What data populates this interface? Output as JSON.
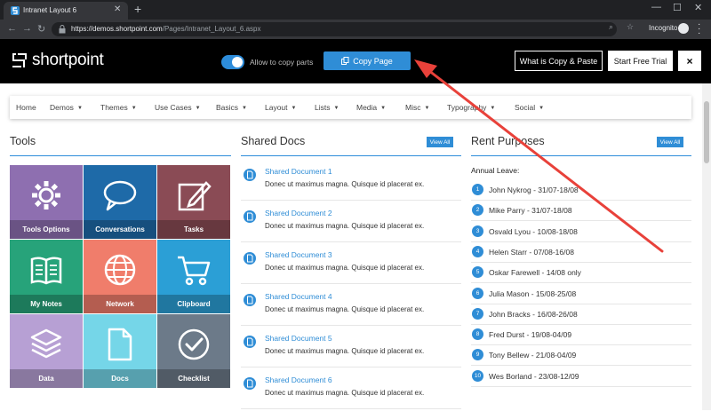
{
  "browser": {
    "tab_title": "Intranet Layout 6",
    "url_host": "https://demos.shortpoint.com",
    "url_path": "/Pages/Intranet_Layout_6.aspx",
    "incognito_label": "Incognito"
  },
  "header": {
    "logo_text": "shortpoint",
    "toggle_label": "Allow to copy parts",
    "toggle_on": true,
    "copy_button": "Copy Page",
    "what_button": "What is Copy & Paste",
    "trial_button": "Start Free Trial",
    "close_button": "×"
  },
  "nav": {
    "items": [
      {
        "label": "Home",
        "has_caret": false
      },
      {
        "label": "Demos",
        "has_caret": true
      },
      {
        "label": "Themes",
        "has_caret": true
      },
      {
        "label": "Use Cases",
        "has_caret": true
      },
      {
        "label": "Basics",
        "has_caret": true
      },
      {
        "label": "Layout",
        "has_caret": true
      },
      {
        "label": "Lists",
        "has_caret": true
      },
      {
        "label": "Media",
        "has_caret": true
      },
      {
        "label": "Misc",
        "has_caret": true
      },
      {
        "label": "Typography",
        "has_caret": true
      },
      {
        "label": "Social",
        "has_caret": true
      }
    ]
  },
  "tools": {
    "title": "Tools",
    "tiles": [
      {
        "label": "Tools Options",
        "icon": "gear-icon",
        "color": "#8e6fb0"
      },
      {
        "label": "Conversations",
        "icon": "chat-bubble-icon",
        "color": "#1e6aa8"
      },
      {
        "label": "Tasks",
        "icon": "pencil-square-icon",
        "color": "#8a4b55"
      },
      {
        "label": "My Notes",
        "icon": "open-book-icon",
        "color": "#27a37a"
      },
      {
        "label": "Network",
        "icon": "globe-icon",
        "color": "#f07d6b"
      },
      {
        "label": "Clipboard",
        "icon": "cart-icon",
        "color": "#2b9fd6"
      },
      {
        "label": "Data",
        "icon": "layers-icon",
        "color": "#b7a0d4"
      },
      {
        "label": "Docs",
        "icon": "document-icon",
        "color": "#75d6e8"
      },
      {
        "label": "Checklist",
        "icon": "check-circle-icon",
        "color": "#6c7a89"
      }
    ]
  },
  "shared_docs": {
    "title": "Shared Docs",
    "view_all": "View All",
    "items": [
      {
        "title": "Shared Document 1",
        "desc": "Donec ut maximus magna. Quisque id placerat ex."
      },
      {
        "title": "Shared Document 2",
        "desc": "Donec ut maximus magna. Quisque id placerat ex."
      },
      {
        "title": "Shared Document 3",
        "desc": "Donec ut maximus magna. Quisque id placerat ex."
      },
      {
        "title": "Shared Document 4",
        "desc": "Donec ut maximus magna. Quisque id placerat ex."
      },
      {
        "title": "Shared Document 5",
        "desc": "Donec ut maximus magna. Quisque id placerat ex."
      },
      {
        "title": "Shared Document 6",
        "desc": "Donec ut maximus magna. Quisque id placerat ex."
      }
    ]
  },
  "rent": {
    "title": "Rent Purposes",
    "view_all": "View All",
    "subtitle": "Annual Leave:",
    "items": [
      {
        "num": "1",
        "text": "John Nykrog - 31/07-18/08"
      },
      {
        "num": "2",
        "text": "Mike Parry - 31/07-18/08"
      },
      {
        "num": "3",
        "text": "Osvald Lyou - 10/08-18/08"
      },
      {
        "num": "4",
        "text": "Helen Starr - 07/08-16/08"
      },
      {
        "num": "5",
        "text": "Oskar Farewell - 14/08 only"
      },
      {
        "num": "6",
        "text": "Julia Mason - 15/08-25/08"
      },
      {
        "num": "7",
        "text": "John Bracks - 16/08-26/08"
      },
      {
        "num": "8",
        "text": "Fred Durst - 19/08-04/09"
      },
      {
        "num": "9",
        "text": "Tony Bellew - 21/08-04/09"
      },
      {
        "num": "10",
        "text": "Wes Borland - 23/08-12/09"
      }
    ]
  },
  "colors": {
    "accent": "#2f8dd6",
    "arrow": "#e8413a"
  }
}
